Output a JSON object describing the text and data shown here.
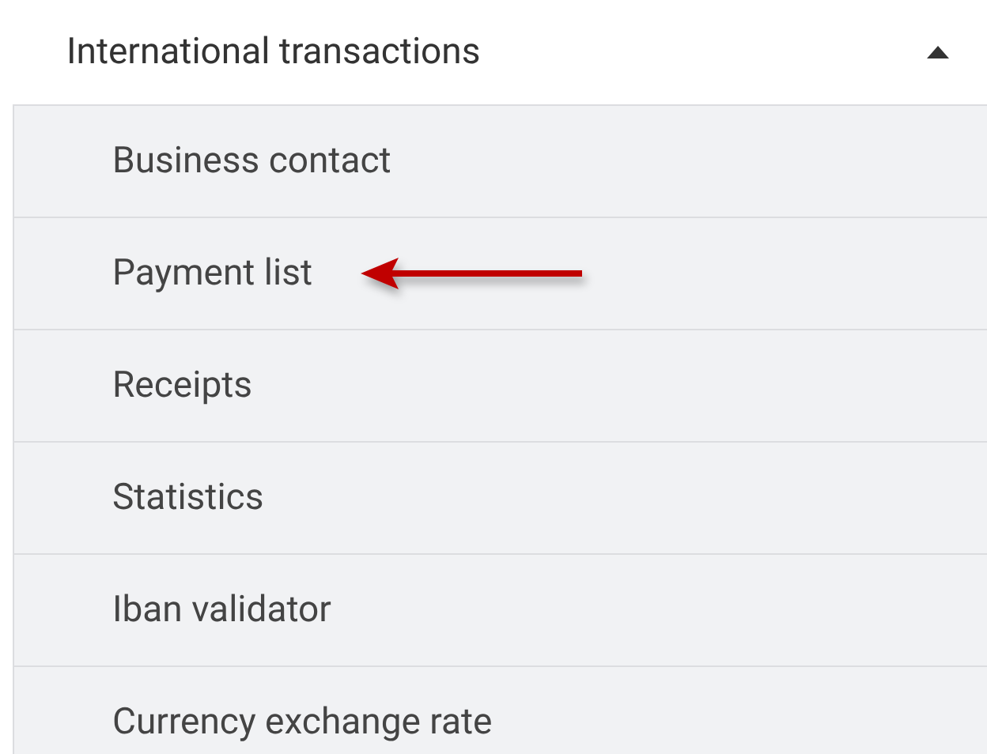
{
  "menu": {
    "title": "International transactions",
    "expanded": true,
    "items": [
      {
        "label": "Business contact",
        "marked": false
      },
      {
        "label": "Payment list",
        "marked": true
      },
      {
        "label": "Receipts",
        "marked": false
      },
      {
        "label": "Statistics",
        "marked": false
      },
      {
        "label": "Iban validator",
        "marked": false
      },
      {
        "label": "Currency exchange rate",
        "marked": false
      }
    ]
  }
}
